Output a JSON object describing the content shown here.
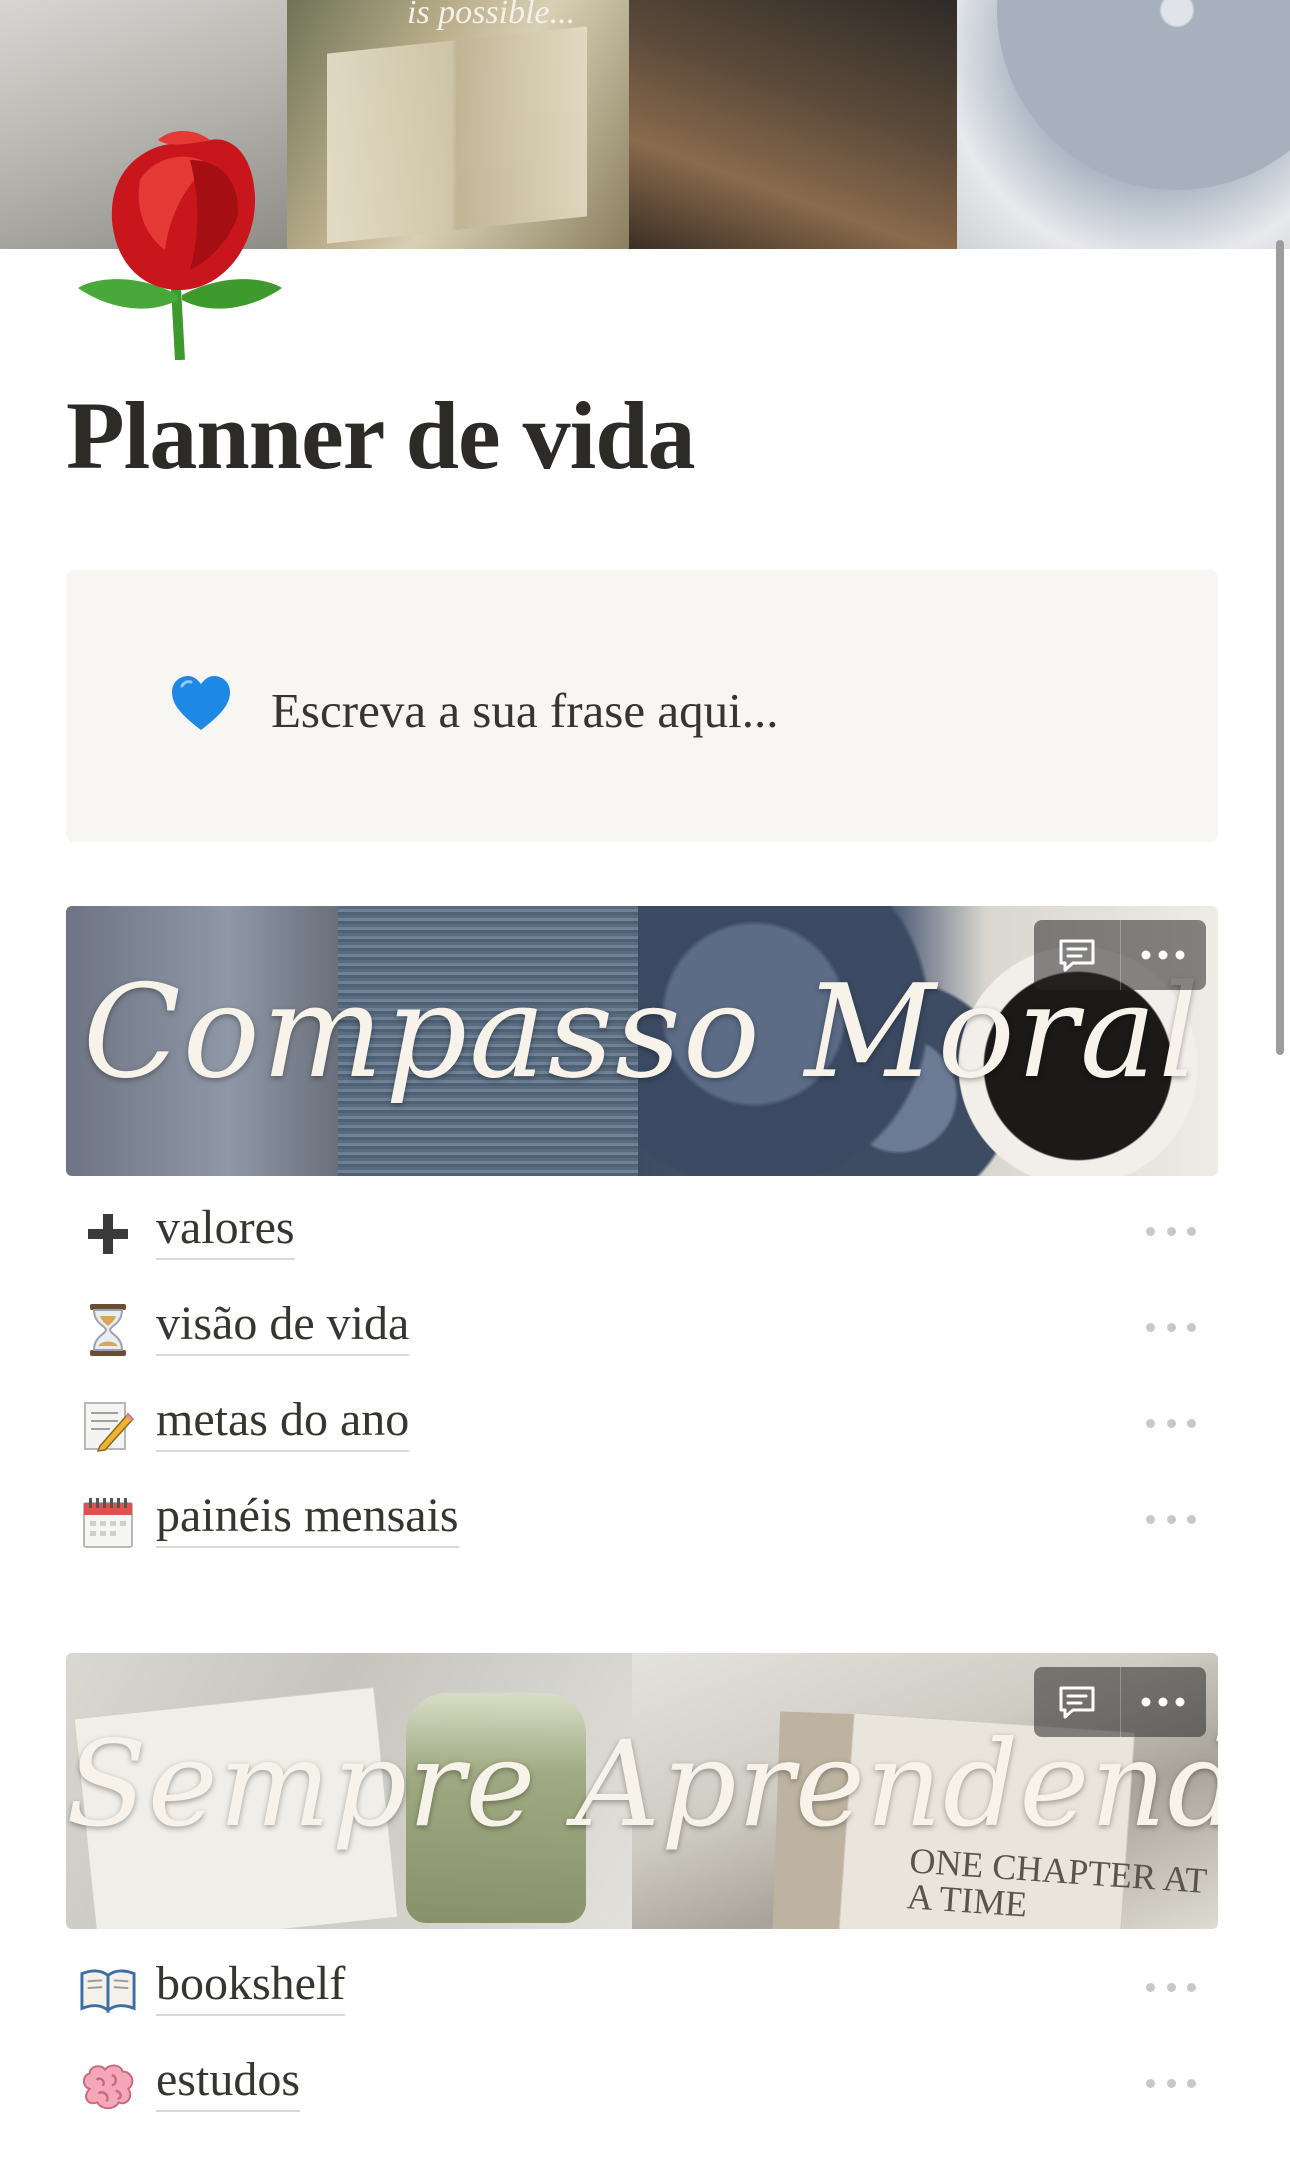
{
  "cover": {
    "quote_fragment": "is possible..."
  },
  "page": {
    "icon": "rose-icon",
    "title": "Planner de vida"
  },
  "callout": {
    "icon": "blue-heart-icon",
    "text": "Escreva a sua frase aqui..."
  },
  "sections": [
    {
      "banner_title": "Compasso Moral",
      "links": [
        {
          "icon": "plus-icon",
          "label": "valores"
        },
        {
          "icon": "hourglass-icon",
          "label": "visão de vida"
        },
        {
          "icon": "memo-pencil-icon",
          "label": "metas do ano"
        },
        {
          "icon": "spiral-calendar-icon",
          "label": "painéis mensais"
        }
      ]
    },
    {
      "banner_title": "Sempre Aprendendo",
      "banner_book_text": "ONE CHAPTER AT A TIME",
      "links": [
        {
          "icon": "open-book-icon",
          "label": "bookshelf"
        },
        {
          "icon": "brain-icon",
          "label": "estudos"
        }
      ]
    }
  ],
  "colors": {
    "title": "#2d2b28",
    "text": "#37352f",
    "callout_bg": "#f7f6f3",
    "heart": "#1e88e5",
    "rose": "#d81b1b"
  }
}
